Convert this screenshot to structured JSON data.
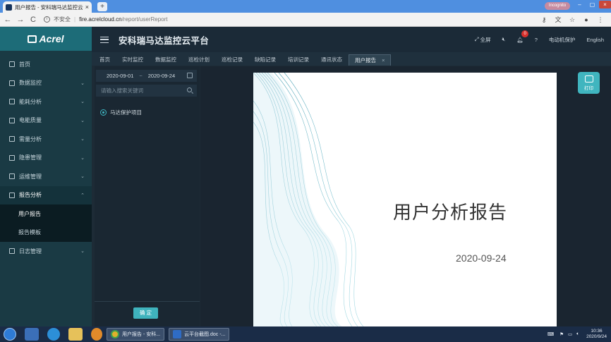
{
  "browser": {
    "tab_title": "用户报告 - 安科瑞马达监控云平台",
    "tab_close": "×",
    "new_tab": "+",
    "profile": "Incognito",
    "back": "←",
    "forward": "→",
    "reload": "C",
    "insecure": "不安全",
    "url_host": "fire.acrelcloud.cn",
    "url_path": "/report/userReport"
  },
  "app": {
    "logo_text": "Acrel",
    "title": "安科瑞马达监控云平台",
    "header": {
      "fullscreen": "全屏",
      "notifications_count": "0",
      "device_name": "电动机保护",
      "language": "English"
    }
  },
  "sidebar": {
    "items": [
      {
        "label": "首页"
      },
      {
        "label": "数据监控"
      },
      {
        "label": "能耗分析"
      },
      {
        "label": "电能质量"
      },
      {
        "label": "需量分析"
      },
      {
        "label": "隐患管理"
      },
      {
        "label": "运维管理"
      },
      {
        "label": "报告分析"
      },
      {
        "label": "用户报告"
      },
      {
        "label": "报告模板"
      },
      {
        "label": "日志管理"
      }
    ]
  },
  "tabs": [
    {
      "label": "首页"
    },
    {
      "label": "实时监控"
    },
    {
      "label": "数据监控"
    },
    {
      "label": "巡检计划"
    },
    {
      "label": "巡检记录"
    },
    {
      "label": "缺陷记录"
    },
    {
      "label": "培训记录"
    },
    {
      "label": "通讯状态"
    },
    {
      "label": "用户报告"
    }
  ],
  "filter": {
    "date_start": "2020-09-01",
    "date_sep": "~",
    "date_end": "2020-09-24",
    "search_placeholder": "请输入搜索关键词",
    "project": "马达保护项目",
    "confirm": "确 定"
  },
  "report": {
    "title": "用户分析报告",
    "date": "2020-09-24",
    "print": "打印"
  },
  "taskbar": {
    "chrome_item": "用户报告 - 安科...",
    "word_item": "云平台截图.doc -...",
    "time": "10:36",
    "date": "2020/9/24"
  },
  "colors": {
    "accent": "#40b5bf",
    "sidebar": "#1a3a44",
    "logo_bg": "#1d6c78",
    "header": "#1b2a37",
    "badge": "#d9302c"
  }
}
